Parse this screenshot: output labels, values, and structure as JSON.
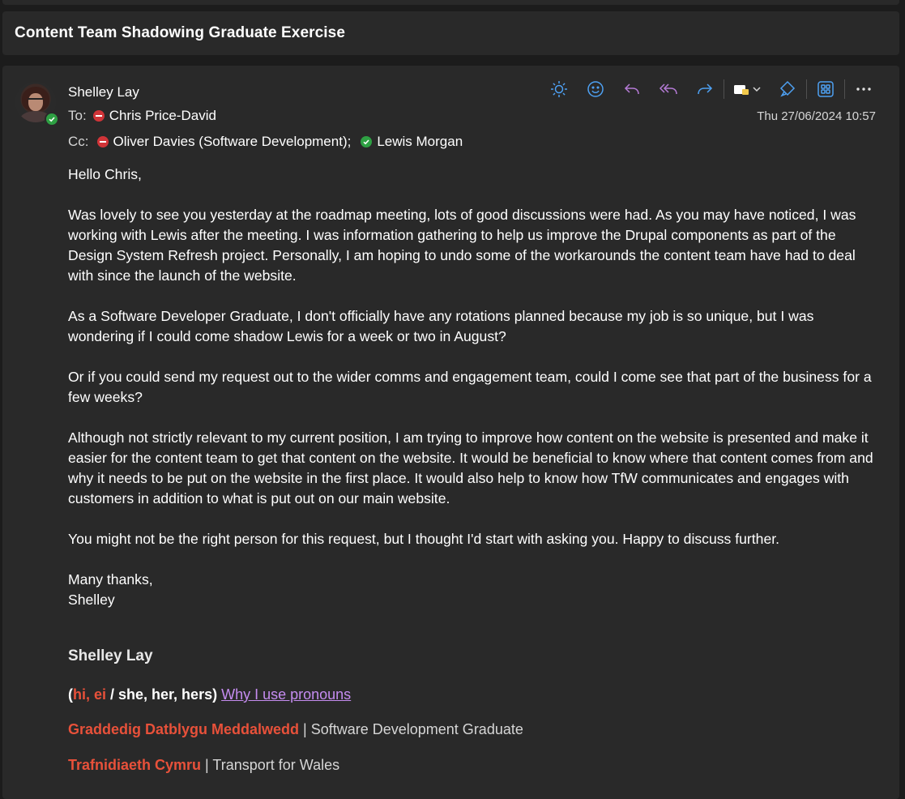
{
  "message": {
    "subject": "Content Team Shadowing Graduate Exercise",
    "sender": "Shelley Lay",
    "to_label": "To:",
    "to": [
      {
        "name": "Chris Price-David",
        "status": "busy"
      }
    ],
    "cc_label": "Cc:",
    "cc": [
      {
        "name": "Oliver Davies (Software Development);",
        "status": "busy"
      },
      {
        "name": "Lewis Morgan",
        "status": "available"
      }
    ],
    "timestamp": "Thu 27/06/2024 10:57",
    "body": [
      "Hello Chris,",
      "Was lovely to see you yesterday at the roadmap meeting, lots of good discussions were had.  As you may have noticed, I was working with Lewis after the meeting.  I was information gathering to help us improve the Drupal components as part of the Design System Refresh project.  Personally, I am hoping to undo some of the workarounds the content team have had to deal with since the launch of the website.",
      "As a Software Developer Graduate, I don't officially have any rotations planned because my job is so unique, but I was wondering if I could come shadow Lewis for a week or two in August?",
      "Or if you could send my request out to the wider comms and engagement team, could I come see that part of the business for a few weeks?",
      "Although not strictly relevant to my current position, I am trying to improve how content on the website is presented and make it easier for the content team to get that content on the website.  It would be beneficial to know where that content comes from and why it needs to be put on the website in the first place.  It would also help to know how TfW communicates and engages with customers in addition to what is put out on our main website.",
      "You might not be the right person for this request, but I thought I'd start with asking you.  Happy to discuss further."
    ],
    "closing_line1": "Many thanks,",
    "closing_line2": "Shelley"
  },
  "signature": {
    "name": "Shelley Lay",
    "pronoun_open": "(",
    "pronoun_welsh": "hi, ei",
    "pronoun_english": " / she, her, hers)",
    "pronoun_link": "Why I use pronouns",
    "role_welsh": "Graddedig Datblygu Meddalwedd",
    "separator": " | ",
    "role_english": "Software Development Graduate",
    "org_welsh": "Trafnidiaeth Cymru",
    "org_english": "Transport for Wales"
  },
  "toolbar": {
    "icons": [
      "sun-icon",
      "emoji-icon",
      "reply-icon",
      "reply-all-icon",
      "forward-icon",
      "teams-share-icon",
      "immersive-reader-icon",
      "apps-icon",
      "more-icon"
    ]
  },
  "colors": {
    "background": "#1c1c1c",
    "panel": "#292929",
    "accent_blue": "#4ea1f3",
    "reply_purple": "#b57bd6",
    "signature_red": "#e8513a",
    "link_purple": "#c58cf0",
    "status_busy": "#d13438",
    "status_available": "#2ea043"
  }
}
